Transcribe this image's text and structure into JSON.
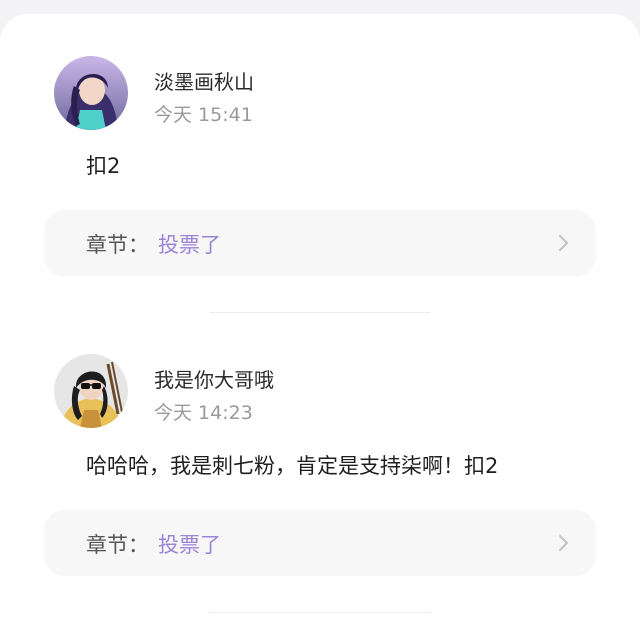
{
  "comments": [
    {
      "user": "淡墨画秋山",
      "time": "今天 15:41",
      "text": "扣2",
      "chapter_label": "章节：",
      "chapter_value": "投票了",
      "avatar_icon": "avatar-purple-haired-girl"
    },
    {
      "user": "我是你大哥哦",
      "time": "今天 14:23",
      "text": "哈哈哈，我是刺七粉，肯定是支持柒啊！扣2",
      "chapter_label": "章节：",
      "chapter_value": "投票了",
      "avatar_icon": "avatar-archer-with-sunglasses"
    }
  ],
  "colors": {
    "accent": "#9b84d6",
    "background": "#f3f3f5",
    "card": "#ffffff"
  }
}
